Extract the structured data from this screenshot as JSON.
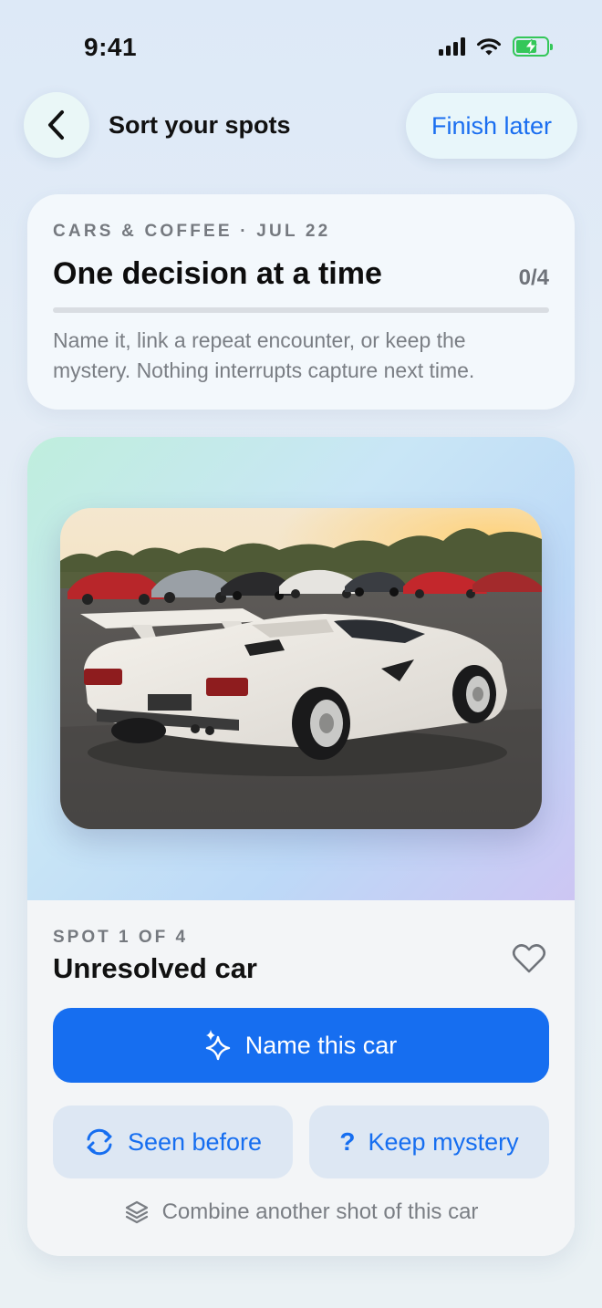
{
  "status": {
    "time": "9:41"
  },
  "header": {
    "title": "Sort your spots",
    "finish_label": "Finish later"
  },
  "summary": {
    "eyebrow": "CARS & COFFEE · JUL 22",
    "title": "One decision at a time",
    "progress_text": "0/4",
    "progress_fraction": 0,
    "description": "Name it, link a repeat encounter, or keep the mystery. Nothing interrupts capture next time."
  },
  "spot": {
    "eyebrow": "SPOT 1 OF 4",
    "title": "Unresolved car",
    "primary_label": "Name this car",
    "seen_before_label": "Seen before",
    "keep_mystery_label": "Keep mystery",
    "combine_label": "Combine another shot of this car"
  },
  "colors": {
    "accent": "#166ef0",
    "battery": "#34c759"
  },
  "icons": {
    "back": "chevron-left-icon",
    "favorite": "heart-outline-icon",
    "primary": "sparkles-icon",
    "seen_before": "refresh-icon",
    "keep_mystery": "question-mark-icon",
    "combine": "stack-layers-icon"
  }
}
